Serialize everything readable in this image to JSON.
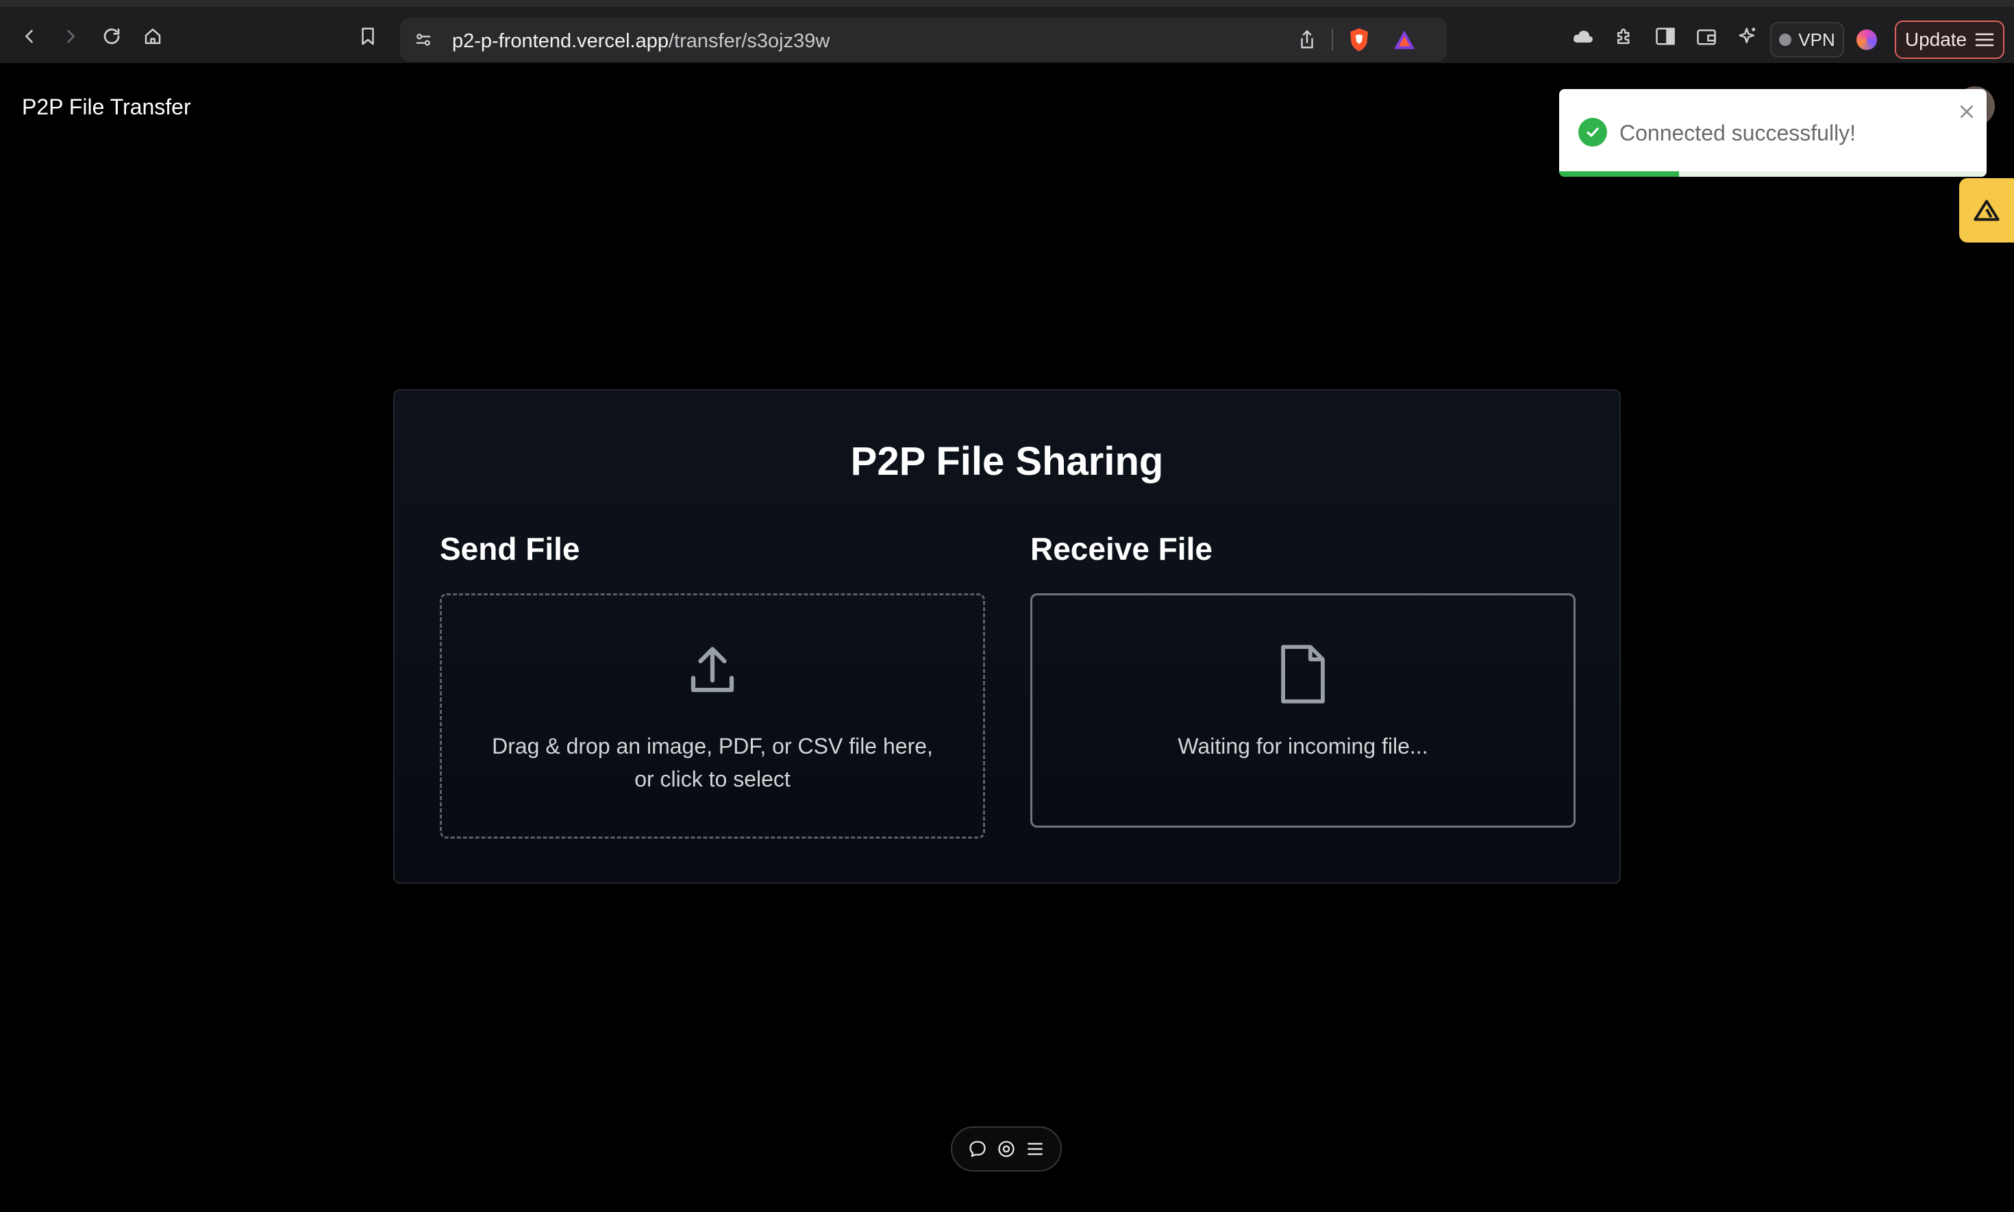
{
  "browser": {
    "url_host": "p2-p-frontend.vercel.app",
    "url_path": "/transfer/s3ojz39w",
    "vpn_label": "VPN",
    "update_label": "Update",
    "icons": [
      "back-icon",
      "forward-icon",
      "reload-icon",
      "home-icon",
      "bookmark-icon",
      "site-settings-icon",
      "share-icon",
      "brave-shield-icon",
      "brave-rewards-icon",
      "cloud-icon",
      "extensions-icon",
      "sidebar-icon",
      "wallet-icon",
      "leo-ai-icon",
      "menu-icon"
    ]
  },
  "header": {
    "site_title": "P2P File Transfer"
  },
  "card": {
    "title": "P2P File Sharing",
    "send": {
      "heading": "Send File",
      "line1": "Drag & drop an image, PDF, or CSV file here,",
      "line2": "or click to select",
      "icon": "upload-icon"
    },
    "receive": {
      "heading": "Receive File",
      "status": "Waiting for incoming file...",
      "icon": "file-icon"
    }
  },
  "toast": {
    "message": "Connected successfully!",
    "status_color": "#2fb34a",
    "progress": 0.28
  },
  "devbar": {
    "icons": [
      "comment-icon",
      "eye-icon",
      "menu-lines-icon"
    ]
  },
  "colors": {
    "background": "#000000",
    "card": "#0b1018",
    "side_tab": "#f7c948"
  }
}
